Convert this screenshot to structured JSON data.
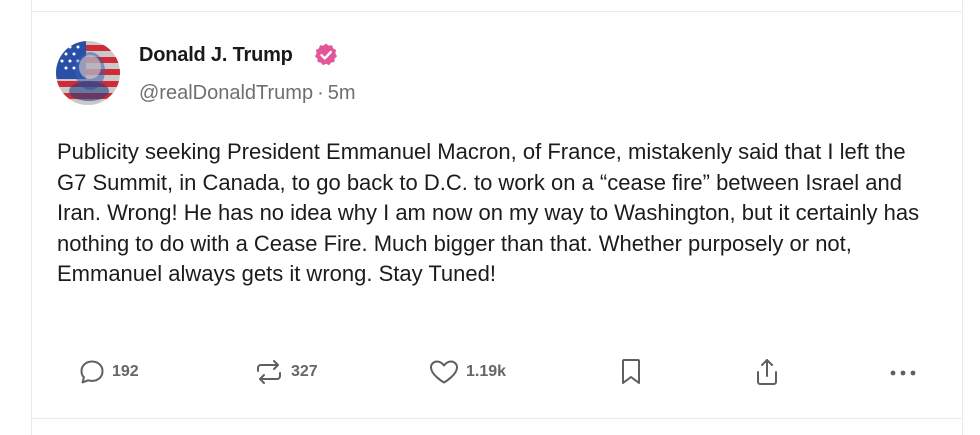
{
  "post": {
    "author": {
      "display_name": "Donald J. Trump",
      "handle": "@realDonaldTrump",
      "separator": "·",
      "time_ago": "5m",
      "verified_color": "#e3569a"
    },
    "body": "Publicity seeking President Emmanuel Macron, of France, mistakenly said that I left the G7 Summit, in Canada, to go back to D.C. to work on a “cease fire” between Israel and Iran. Wrong! He has no idea why I am now on my way to Washington, but it certainly has nothing to do with a Cease Fire. Much bigger than that. Whether purposely or not, Emmanuel always gets it wrong. Stay Tuned!",
    "actions": {
      "replies": {
        "icon": "reply-icon",
        "count": "192"
      },
      "retruths": {
        "icon": "retruth-icon",
        "count": "327"
      },
      "likes": {
        "icon": "heart-icon",
        "count": "1.19k"
      },
      "bookmark": {
        "icon": "bookmark-icon"
      },
      "share": {
        "icon": "share-icon"
      },
      "more": {
        "icon": "more-icon"
      }
    }
  }
}
